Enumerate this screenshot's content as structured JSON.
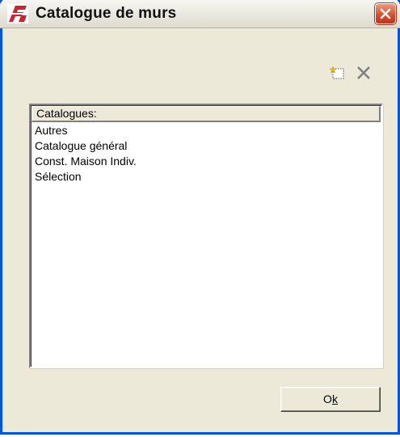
{
  "window": {
    "title": "Catalogue de murs",
    "accent_color": "#0054e3",
    "close_color": "#d84a26"
  },
  "toolbar": {
    "new_icon": "new-document-icon",
    "delete_icon": "delete-x-icon"
  },
  "list": {
    "header": "Catalogues:",
    "items": [
      "Autres",
      "Catalogue général",
      "Const. Maison Indiv.",
      "Sélection"
    ]
  },
  "buttons": {
    "ok_prefix": "O",
    "ok_underlined": "k"
  }
}
